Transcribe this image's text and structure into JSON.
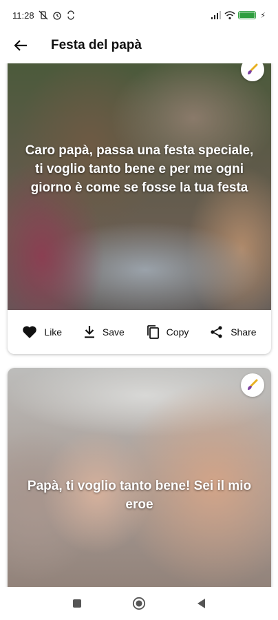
{
  "status_bar": {
    "time": "11:28",
    "icons": [
      "vibrate-off-icon",
      "alarm-icon",
      "sync-icon",
      "signal-icon",
      "wifi-icon",
      "battery-icon",
      "charging-icon"
    ]
  },
  "app_bar": {
    "title": "Festa del papà",
    "back_icon": "arrow-left-icon"
  },
  "cards": [
    {
      "quote": "Caro papà, passa una festa speciale, ti voglio tanto bene e per me ogni giorno è come se fosse la tua festa",
      "badge_icon": "brush-icon",
      "actions": {
        "like": "Like",
        "save": "Save",
        "copy": "Copy",
        "share": "Share"
      }
    },
    {
      "quote": "Papà, ti voglio tanto bene! Sei il mio eroe",
      "badge_icon": "brush-icon"
    }
  ],
  "nav_bar": {
    "icons": [
      "recents-square-icon",
      "home-circle-icon",
      "back-triangle-icon"
    ]
  },
  "colors": {
    "accent_battery": "#2e9e3e",
    "text_primary": "#111111",
    "badge_brush_handle": "#e8b020",
    "badge_brush_tip": "#7a3fa0"
  }
}
